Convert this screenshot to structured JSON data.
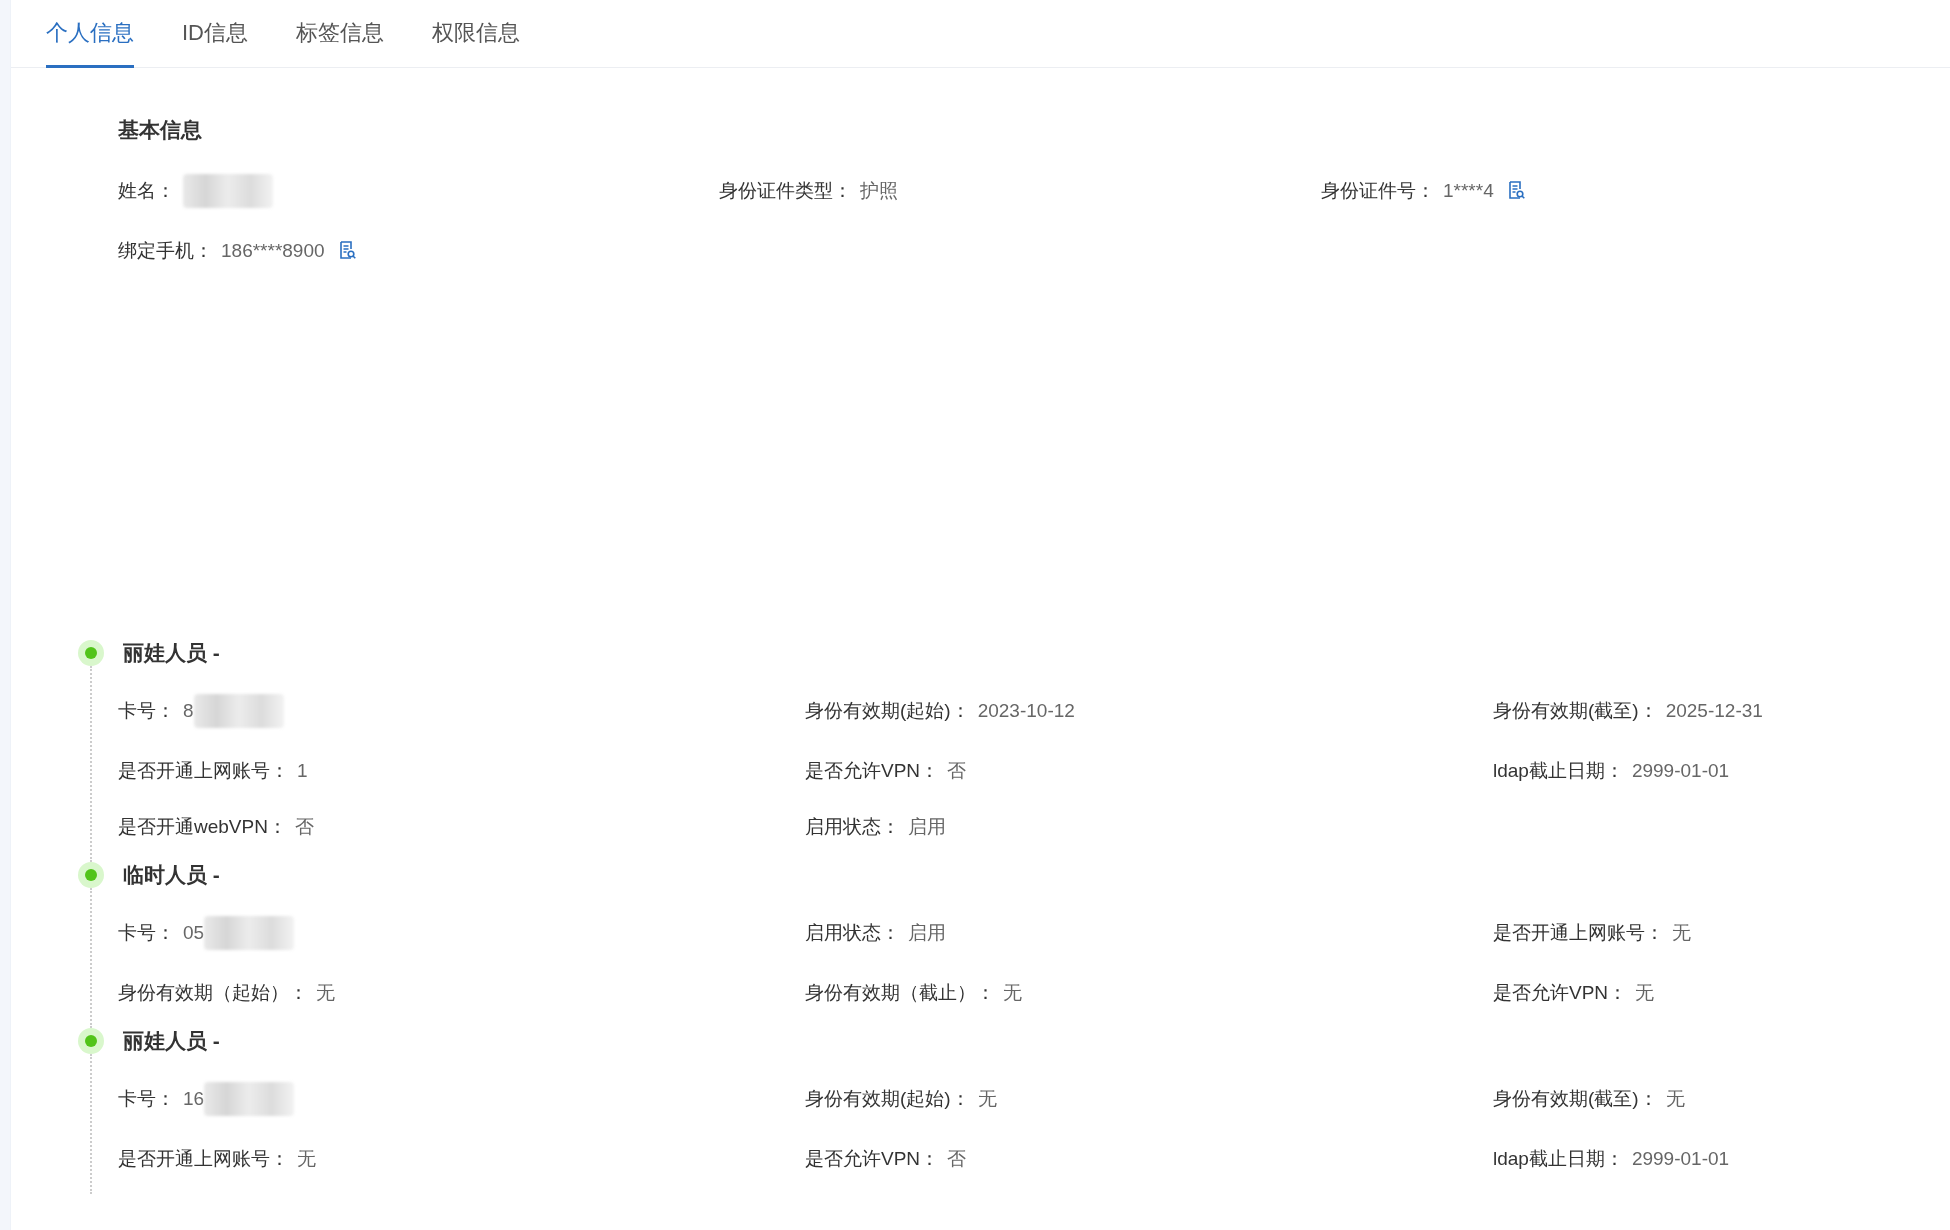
{
  "tabs": [
    {
      "label": "个人信息",
      "selected": true
    },
    {
      "label": "ID信息",
      "selected": false
    },
    {
      "label": "标签信息",
      "selected": false
    },
    {
      "label": "权限信息",
      "selected": false
    }
  ],
  "basic_info": {
    "title": "基本信息",
    "fields": [
      {
        "label": "姓名：",
        "redacted": true
      },
      {
        "label": "身份证件类型：",
        "value": "护照"
      },
      {
        "label": "身份证件号：",
        "value": "1****4",
        "reveal_icon": true
      },
      {
        "label": "绑定手机：",
        "value": "186****8900",
        "reveal_icon": true
      }
    ]
  },
  "timeline": [
    {
      "title": "丽娃人员 -",
      "fields": [
        {
          "label": "卡号：",
          "value": "8",
          "redacted": true
        },
        {
          "label": "身份有效期(起始)：",
          "value": "2023-10-12"
        },
        {
          "label": "身份有效期(截至)：",
          "value": "2025-12-31"
        },
        {
          "label": "是否开通上网账号：",
          "value": "1"
        },
        {
          "label": "是否允许VPN：",
          "value": "否"
        },
        {
          "label": "ldap截止日期：",
          "value": "2999-01-01"
        },
        {
          "label": "是否开通webVPN：",
          "value": "否"
        },
        {
          "label": "启用状态：",
          "value": "启用"
        }
      ]
    },
    {
      "title": "临时人员 -",
      "fields": [
        {
          "label": "卡号：",
          "value": "05",
          "redacted": true
        },
        {
          "label": "启用状态：",
          "value": "启用"
        },
        {
          "label": "是否开通上网账号：",
          "value": "无"
        },
        {
          "label": "身份有效期（起始）：",
          "value": "无"
        },
        {
          "label": "身份有效期（截止）：",
          "value": "无"
        },
        {
          "label": "是否允许VPN：",
          "value": "无"
        }
      ]
    },
    {
      "title": "丽娃人员 -",
      "fields": [
        {
          "label": "卡号：",
          "value": "16",
          "redacted": true
        },
        {
          "label": "身份有效期(起始)：",
          "value": "无"
        },
        {
          "label": "身份有效期(截至)：",
          "value": "无"
        },
        {
          "label": "是否开通上网账号：",
          "value": "无"
        },
        {
          "label": "是否允许VPN：",
          "value": "否"
        },
        {
          "label": "ldap截止日期：",
          "value": "2999-01-01"
        }
      ]
    }
  ]
}
